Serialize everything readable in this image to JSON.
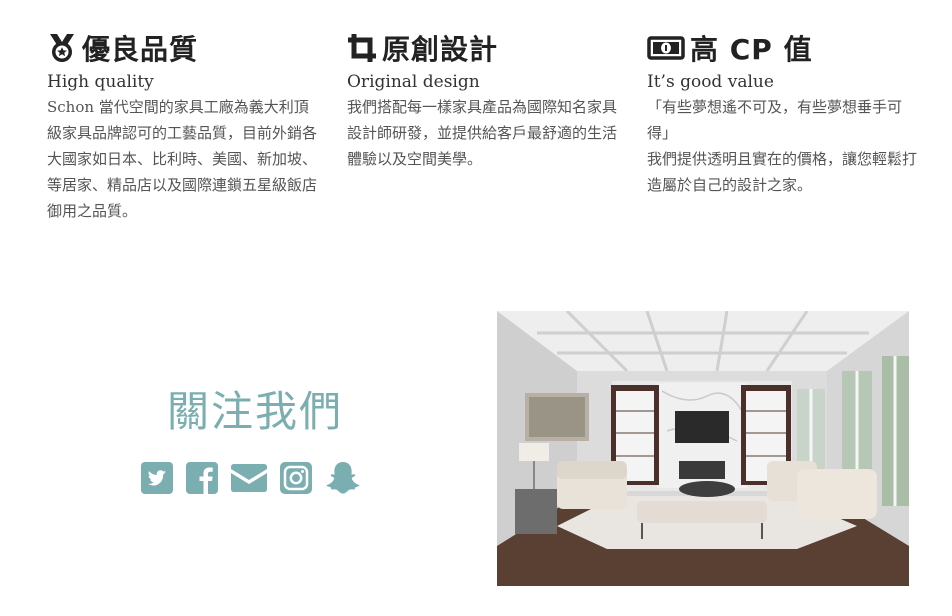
{
  "features": [
    {
      "icon": "medal-icon",
      "title": "優良品質",
      "subtitle": "High quality",
      "body": [
        "Schon 當代空間的家具工廠為義大利頂級家具品牌認可的工藝品質，目前外銷各大國家如日本、比利時、美國、新加坡、等居家、精品店以及國際連鎖五星級飯店御用之品質。"
      ]
    },
    {
      "icon": "crop-icon",
      "title": "原創設計",
      "subtitle": "Original design",
      "body": [
        "我們搭配每一樣家具產品為國際知名家具設計師研發，並提供給客戶最舒適的生活體驗以及空間美學。"
      ]
    },
    {
      "icon": "money-bill-icon",
      "title": "高 CP 值",
      "subtitle": "It’s good value",
      "body": [
        "「有些夢想遙不可及，有些夢想垂手可得」",
        "我們提供透明且實在的價格，讓您輕鬆打造屬於自己的設計之家。"
      ]
    }
  ],
  "follow": {
    "title": "關注我們",
    "socials": [
      "twitter-icon",
      "facebook-icon",
      "email-icon",
      "instagram-icon",
      "snapchat-icon"
    ],
    "accent_color": "#7aaeb0"
  },
  "photo": {
    "subject": "living-room-photo"
  }
}
